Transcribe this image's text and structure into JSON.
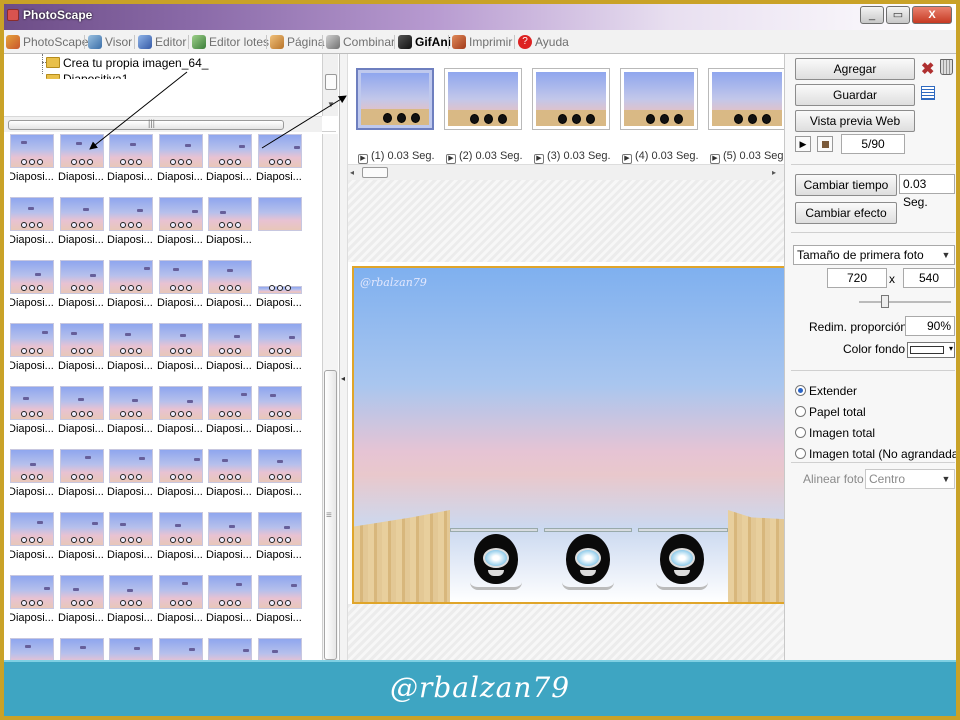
{
  "window": {
    "title": "PhotoScape",
    "controls": {
      "minimize": "_",
      "maximize": "▭",
      "close": "X"
    }
  },
  "tabs": [
    {
      "label": "PhotoScape",
      "icon": "photoscape-icon"
    },
    {
      "label": "Visor",
      "icon": "viewer-icon"
    },
    {
      "label": "Editor",
      "icon": "editor-icon"
    },
    {
      "label": "Editor lotes",
      "icon": "batch-editor-icon"
    },
    {
      "label": "Página",
      "icon": "page-icon"
    },
    {
      "label": "Combinar",
      "icon": "combine-icon"
    },
    {
      "label": "GifAni",
      "icon": "gifani-icon",
      "active": true
    },
    {
      "label": "Imprimir",
      "icon": "print-icon"
    },
    {
      "label": "Ayuda",
      "icon": "help-icon"
    }
  ],
  "tree": {
    "items": [
      "Crea tu propia imagen_64_",
      "Diapositiva1"
    ]
  },
  "thumbnails": {
    "label": "Diaposi..."
  },
  "frames": [
    {
      "label": "(1) 0.03 Seg."
    },
    {
      "label": "(2) 0.03 Seg."
    },
    {
      "label": "(3) 0.03 Seg."
    },
    {
      "label": "(4) 0.03 Seg."
    },
    {
      "label": "(5) 0.03 Seg."
    }
  ],
  "preview": {
    "watermark": "@rbalzan79"
  },
  "right": {
    "agregar": "Agregar",
    "guardar": "Guardar",
    "vista_previa": "Vista previa Web",
    "counter": "5/90",
    "cambiar_tiempo": "Cambiar tiempo",
    "tiempo_value": "0.03 Seg.",
    "cambiar_efecto": "Cambiar efecto",
    "size_select": "Tamaño de primera foto",
    "width": "720",
    "x": "x",
    "height": "540",
    "redim_label": "Redim. proporción",
    "redim_value": "90%",
    "color_fondo": "Color fondo",
    "options": [
      {
        "label": "Extender",
        "checked": true
      },
      {
        "label": "Papel total",
        "checked": false
      },
      {
        "label": "Imagen total",
        "checked": false
      },
      {
        "label": "Imagen total (No agrandada)",
        "checked": false
      }
    ],
    "alinear_label": "Alinear foto",
    "alinear_value": "Centro"
  },
  "banner": {
    "signature": "@rbalzan79"
  },
  "colors": {
    "frame": "#c9a227",
    "banner": "#3ea5c2",
    "sky_top": "#7fb0ef",
    "sky_pink": "#e6c4d4"
  }
}
